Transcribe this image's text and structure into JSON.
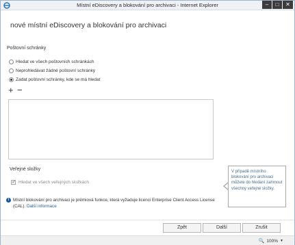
{
  "window": {
    "title": "Místní eDiscovery a blokování pro archivaci - Internet Explorer",
    "controls": {
      "minimize": "–",
      "maximize": "□",
      "close": "✕"
    }
  },
  "page": {
    "title": "nové místní eDiscovery a blokování pro archivaci"
  },
  "mailboxes": {
    "label": "Poštovní schránky",
    "options": [
      {
        "label": "Hledat ve všech poštovních schránkách",
        "checked": false
      },
      {
        "label": "Neprohledávat žádné poštovní schránky",
        "checked": false
      },
      {
        "label": "Zadat poštovní schránky, kde se má hledat",
        "checked": true
      }
    ],
    "add_icon": "+",
    "remove_icon": "−"
  },
  "public_folders": {
    "label": "Veřejné složky",
    "checkbox_label": "Hledat ve všech veřejných složkách",
    "checked": true
  },
  "tooltip": {
    "text": "V případě místního blokování pro archivaci můžete do hledání zahrnout všechny veřejné složky."
  },
  "info": {
    "icon": "i",
    "text": "Místní blokování pro archivaci je prémiová funkce, která vyžaduje licenci Enterprise Client Access License (CAL).",
    "link": "Další informace"
  },
  "buttons": {
    "back": "Zpět",
    "next": "Další",
    "cancel": "Zrušit"
  },
  "statusbar": {
    "zoom": "100%"
  }
}
